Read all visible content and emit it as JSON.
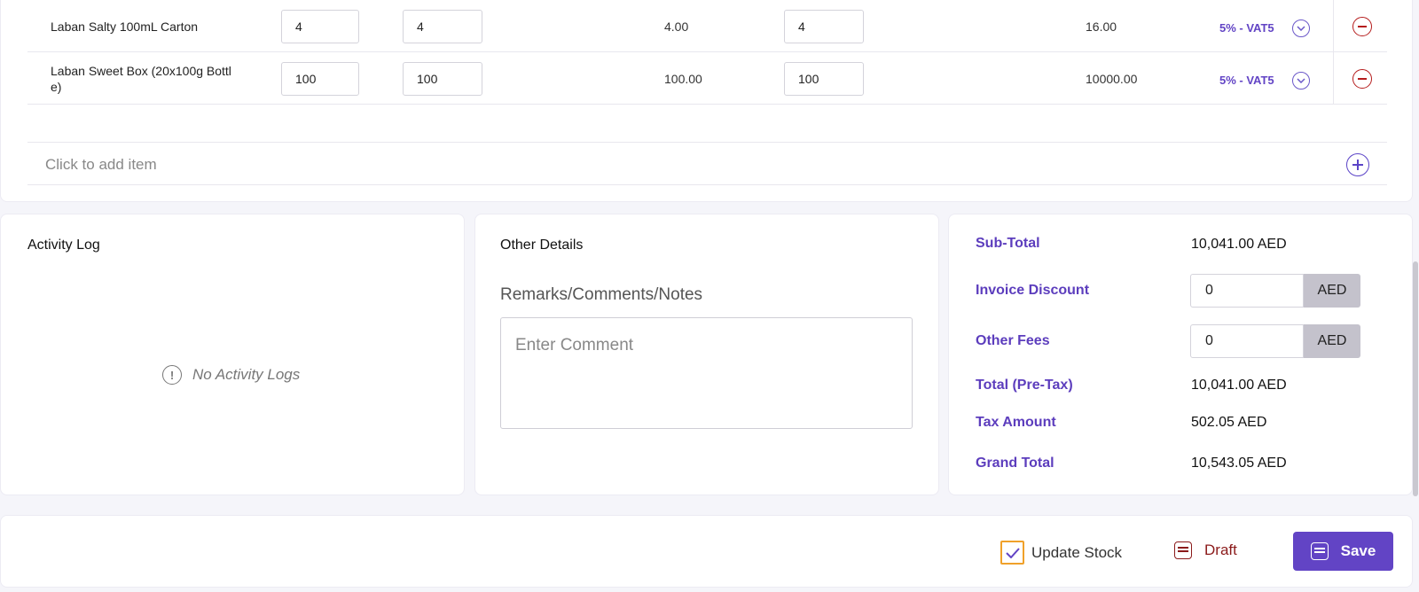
{
  "items": [
    {
      "name": "Laban Salty 100mL Carton",
      "qty1": "4",
      "qty2": "4",
      "price": "4.00",
      "qty3": "4",
      "total": "16.00",
      "vat": "5% - VAT5"
    },
    {
      "name": "Laban Sweet Box (20x100g Bottl e)",
      "qty1": "100",
      "qty2": "100",
      "price": "100.00",
      "qty3": "100",
      "total": "10000.00",
      "vat": "5% - VAT5"
    }
  ],
  "add_item": "Click to add item",
  "activity": {
    "title": "Activity Log",
    "empty": "No Activity Logs"
  },
  "other": {
    "title": "Other Details",
    "remarks_label": "Remarks/Comments/Notes",
    "comment_placeholder": "Enter Comment"
  },
  "totals": {
    "subtotal_label": "Sub-Total",
    "subtotal": "10,041.00 AED",
    "discount_label": "Invoice Discount",
    "discount": "0",
    "discount_unit": "AED",
    "fees_label": "Other Fees",
    "fees": "0",
    "fees_unit": "AED",
    "pretax_label": "Total (Pre-Tax)",
    "pretax": "10,041.00 AED",
    "tax_label": "Tax Amount",
    "tax": "502.05 AED",
    "grand_label": "Grand Total",
    "grand": "10,543.05 AED"
  },
  "footer": {
    "update_stock": "Update Stock",
    "update_stock_checked": true,
    "draft": "Draft",
    "save": "Save"
  },
  "colors": {
    "accent": "#6244c5",
    "danger": "#b51c1c",
    "checkbox": "#f0a12a"
  }
}
